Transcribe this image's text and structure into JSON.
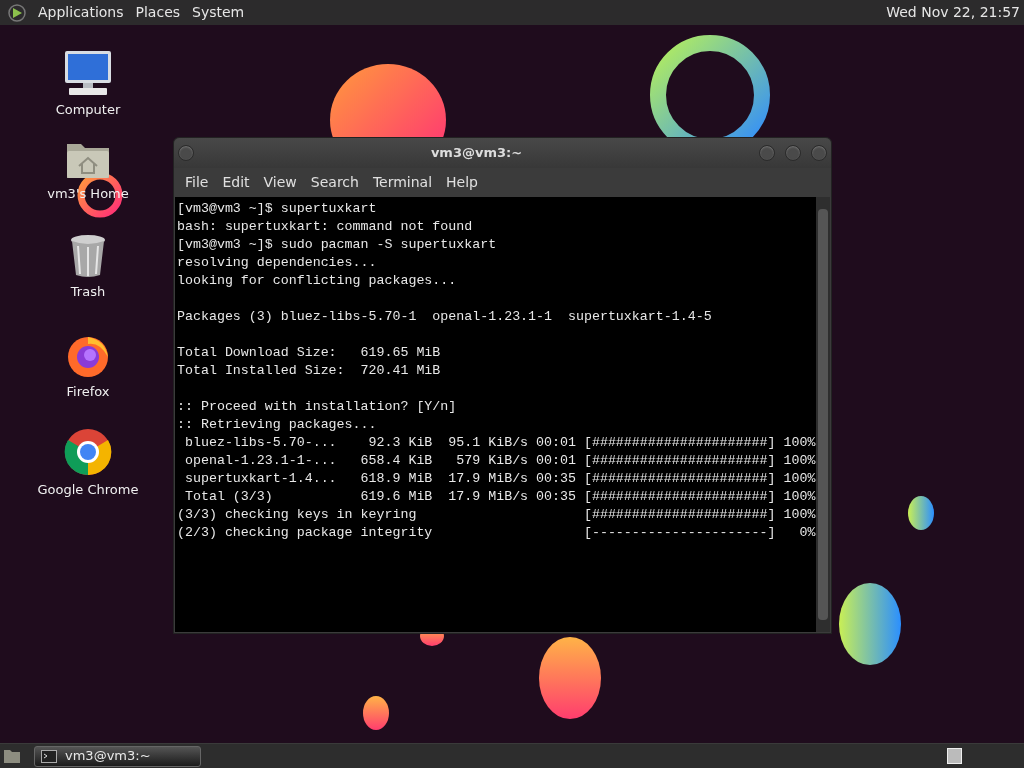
{
  "top_panel": {
    "menus": [
      "Applications",
      "Places",
      "System"
    ],
    "clock": "Wed Nov 22, 21:57"
  },
  "desktop_icons": [
    {
      "label": "Computer",
      "kind": "computer"
    },
    {
      "label": "vm3's Home",
      "kind": "home"
    },
    {
      "label": "Trash",
      "kind": "trash"
    },
    {
      "label": "Firefox",
      "kind": "firefox"
    },
    {
      "label": "Google Chrome",
      "kind": "chrome"
    }
  ],
  "terminal": {
    "title": "vm3@vm3:~",
    "menu": [
      "File",
      "Edit",
      "View",
      "Search",
      "Terminal",
      "Help"
    ],
    "blocks": [
      [
        "[vm3@vm3 ~]$ supertuxkart",
        "bash: supertuxkart: command not found",
        "[vm3@vm3 ~]$ sudo pacman -S supertuxkart",
        "resolving dependencies...",
        "looking for conflicting packages..."
      ],
      [
        "Packages (3) bluez-libs-5.70-1  openal-1.23.1-1  supertuxkart-1.4-5"
      ],
      [
        "Total Download Size:   619.65 MiB",
        "Total Installed Size:  720.41 MiB"
      ],
      [
        ":: Proceed with installation? [Y/n]",
        ":: Retrieving packages...",
        " bluez-libs-5.70-...    92.3 KiB  95.1 KiB/s 00:01 [######################] 100%",
        " openal-1.23.1-1-...   658.4 KiB   579 KiB/s 00:01 [######################] 100%",
        " supertuxkart-1.4...   618.9 MiB  17.9 MiB/s 00:35 [######################] 100%",
        " Total (3/3)           619.6 MiB  17.9 MiB/s 00:35 [######################] 100%",
        "(3/3) checking keys in keyring                     [######################] 100%",
        "(2/3) checking package integrity                   [----------------------]   0%"
      ]
    ]
  },
  "taskbar": {
    "tasks": [
      {
        "label": "vm3@vm3:~",
        "selected": true
      }
    ]
  }
}
